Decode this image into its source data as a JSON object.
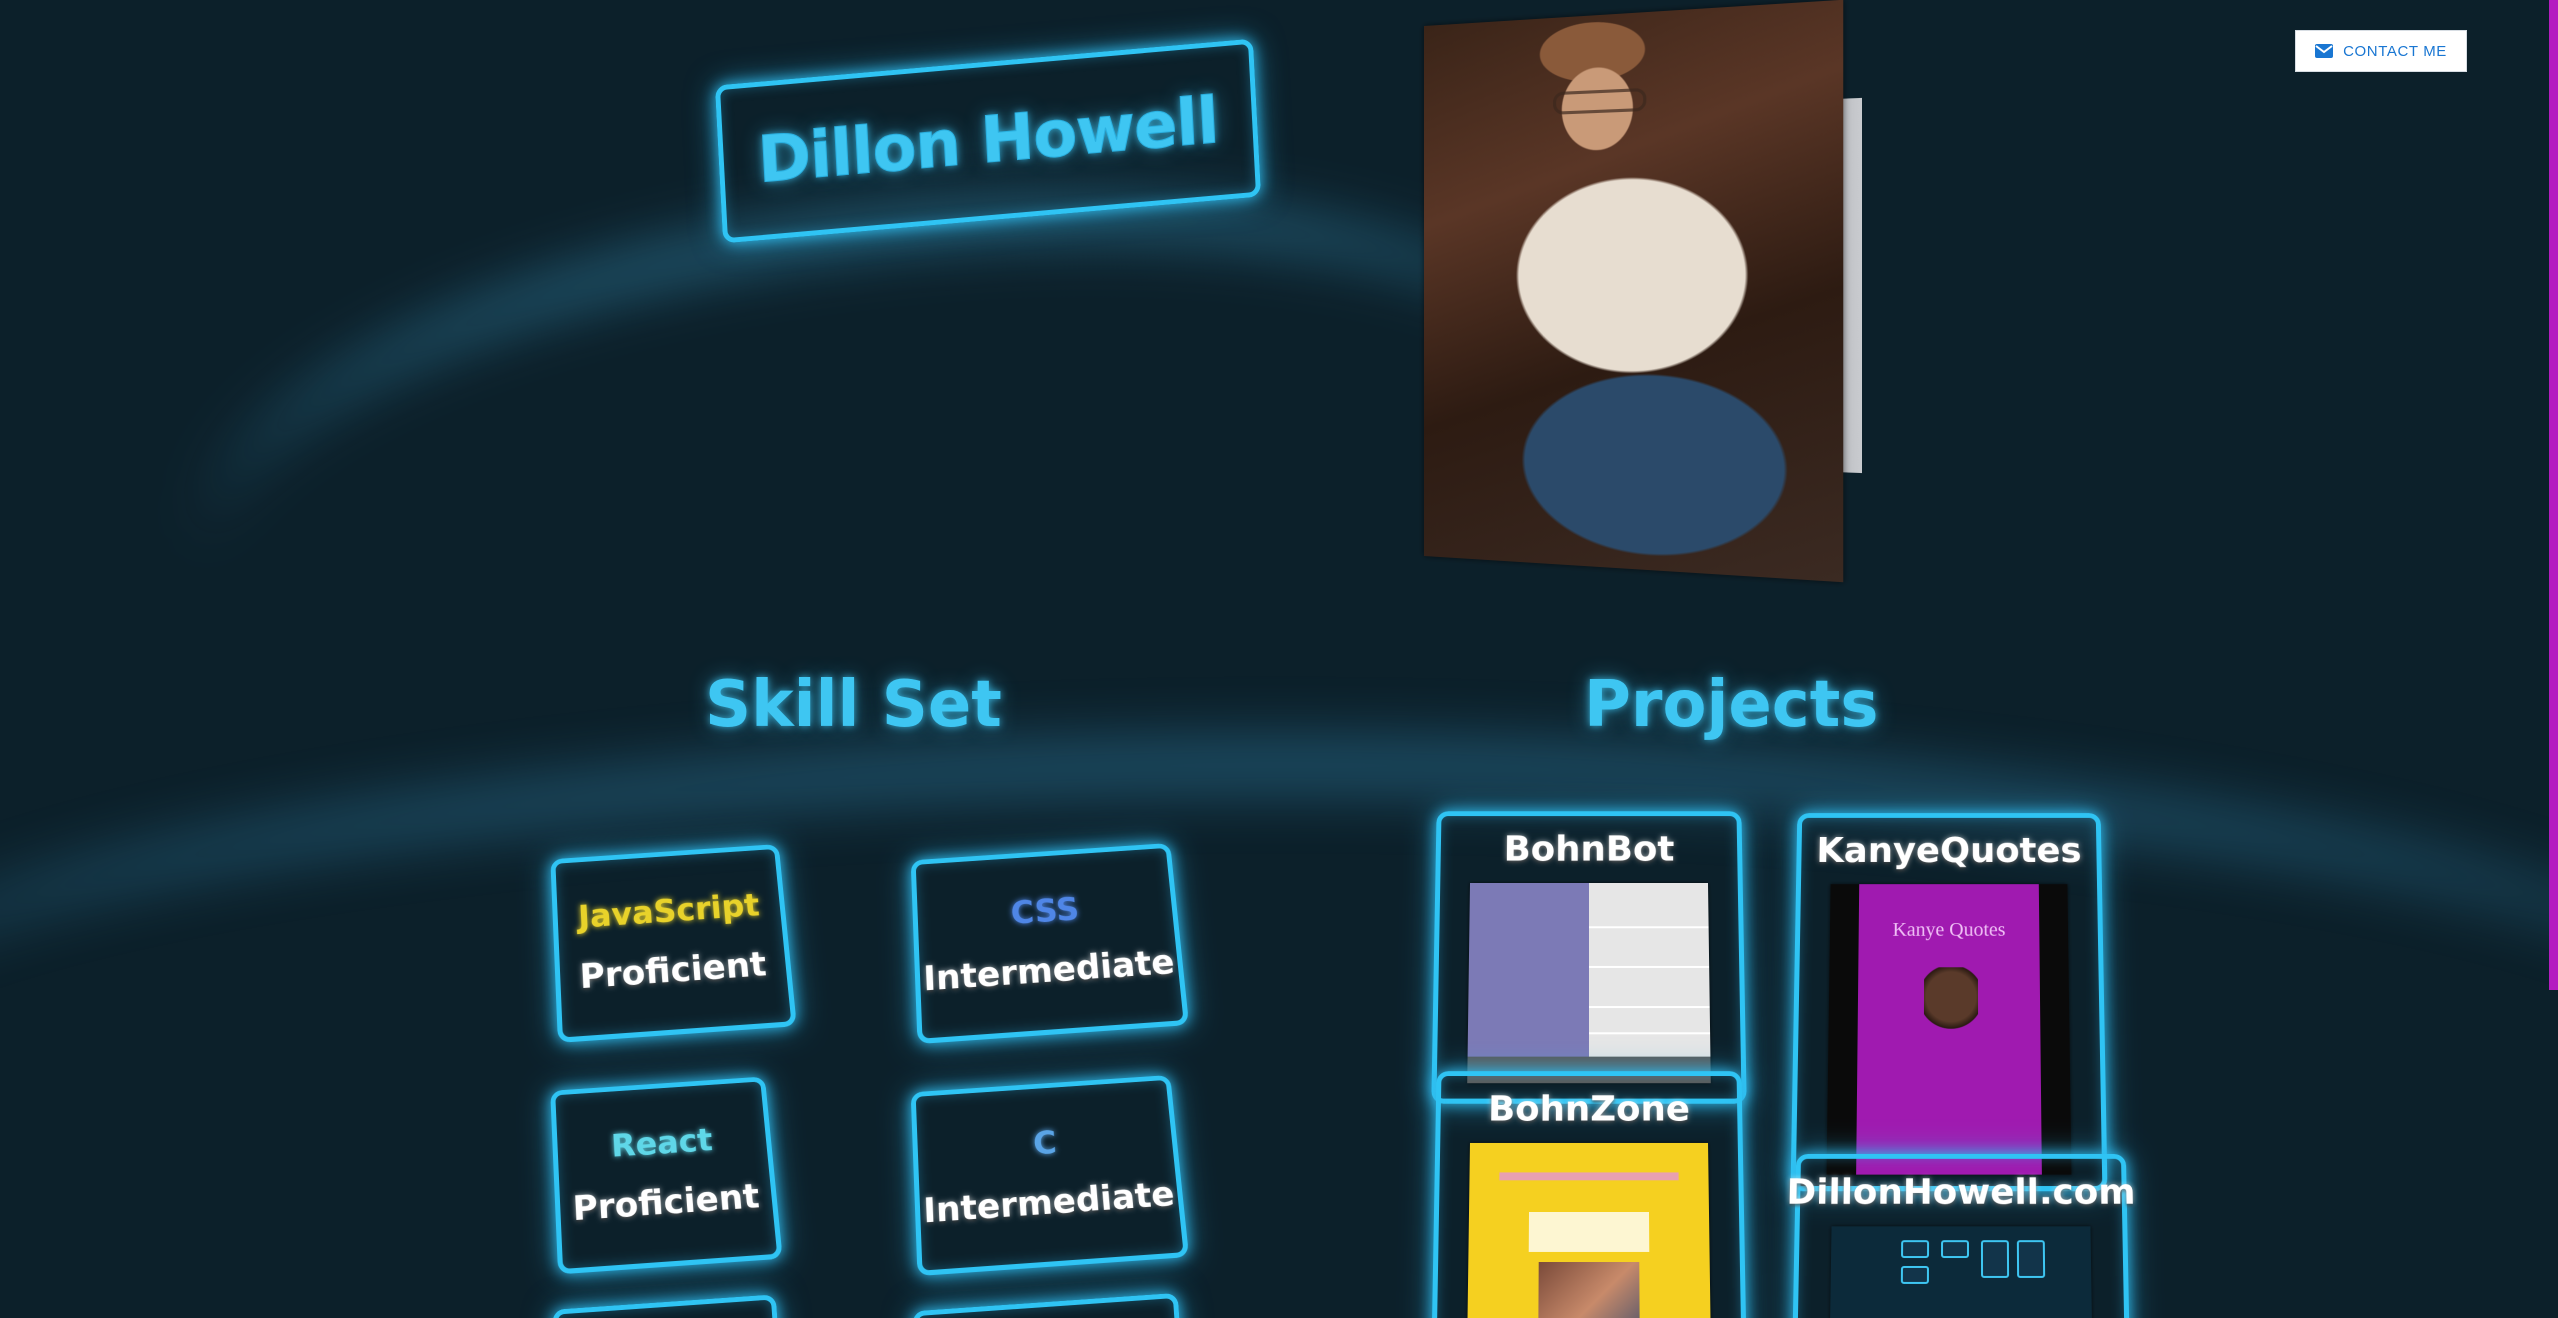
{
  "header": {
    "name": "Dillon Howell",
    "contact_button_label": "CONTACT ME",
    "contact_icon": "mail-icon"
  },
  "sections": {
    "skills_title": "Skill Set",
    "projects_title": "Projects"
  },
  "skills": [
    {
      "name": "JavaScript",
      "level": "Proficient",
      "color": "#e8d22a"
    },
    {
      "name": "CSS",
      "level": "Intermediate",
      "color": "#4f86e6"
    },
    {
      "name": "React",
      "level": "Proficient",
      "color": "#5fd7e8"
    },
    {
      "name": "C",
      "level": "Intermediate",
      "color": "#5aa4e6"
    }
  ],
  "projects": [
    {
      "title": "BohnBot"
    },
    {
      "title": "KanyeQuotes",
      "screenshot_heading": "Kanye Quotes"
    },
    {
      "title": "BohnZone"
    },
    {
      "title": "DillonHowell.com"
    }
  ],
  "colors": {
    "background": "#0c202a",
    "neon": "#2fc4f4",
    "scroll_thumb": "#b41cc0",
    "contact_text": "#1976d2"
  }
}
